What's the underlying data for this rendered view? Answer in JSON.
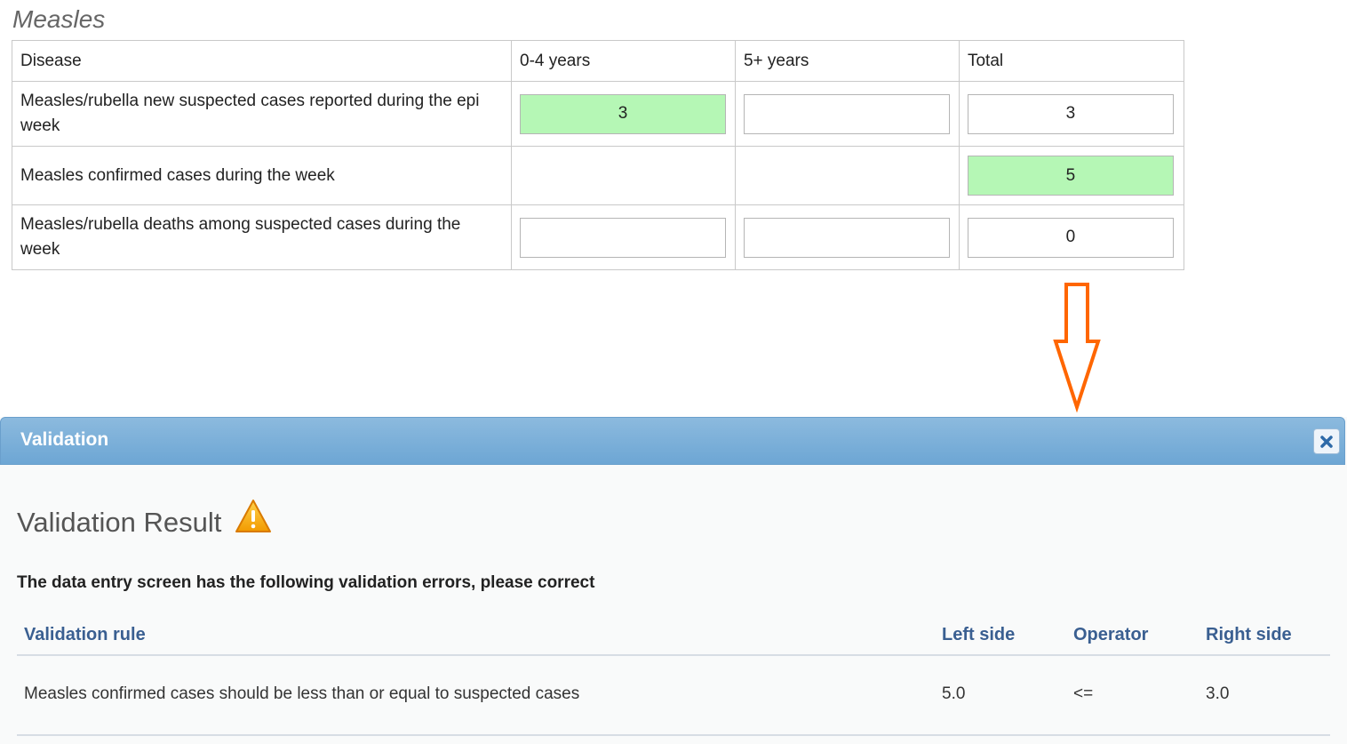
{
  "section": {
    "title": "Measles"
  },
  "form": {
    "headers": [
      "Disease",
      "0-4 years",
      "5+ years",
      "Total"
    ],
    "rows": [
      {
        "label": "Measles/rubella new suspected cases reported during the epi week",
        "age_0_4": "3",
        "age_5_plus": "",
        "total": "3"
      },
      {
        "label": "Measles confirmed cases during the week",
        "total": "5"
      },
      {
        "label": "Measles/rubella deaths among suspected cases during the week",
        "age_0_4": "",
        "age_5_plus": "",
        "total": "0"
      }
    ]
  },
  "colors": {
    "saved_field": "#b5f7b5",
    "arrow": "#ff6600",
    "titlebar": "#7fb2dc",
    "header_text": "#3a5f91"
  },
  "icons": {
    "arrow": "down-arrow-icon",
    "close": "close-icon",
    "warning": "warning-icon"
  },
  "dialog": {
    "title": "Validation",
    "result_title": "Validation Result",
    "message": "The data entry screen has the following validation errors, please correct",
    "table": {
      "headers": [
        "Validation rule",
        "Left side",
        "Operator",
        "Right side"
      ],
      "rows": [
        {
          "rule": "Measles confirmed cases should be less than or equal to suspected cases",
          "left": "5.0",
          "operator": "<=",
          "right": "3.0"
        }
      ]
    }
  }
}
